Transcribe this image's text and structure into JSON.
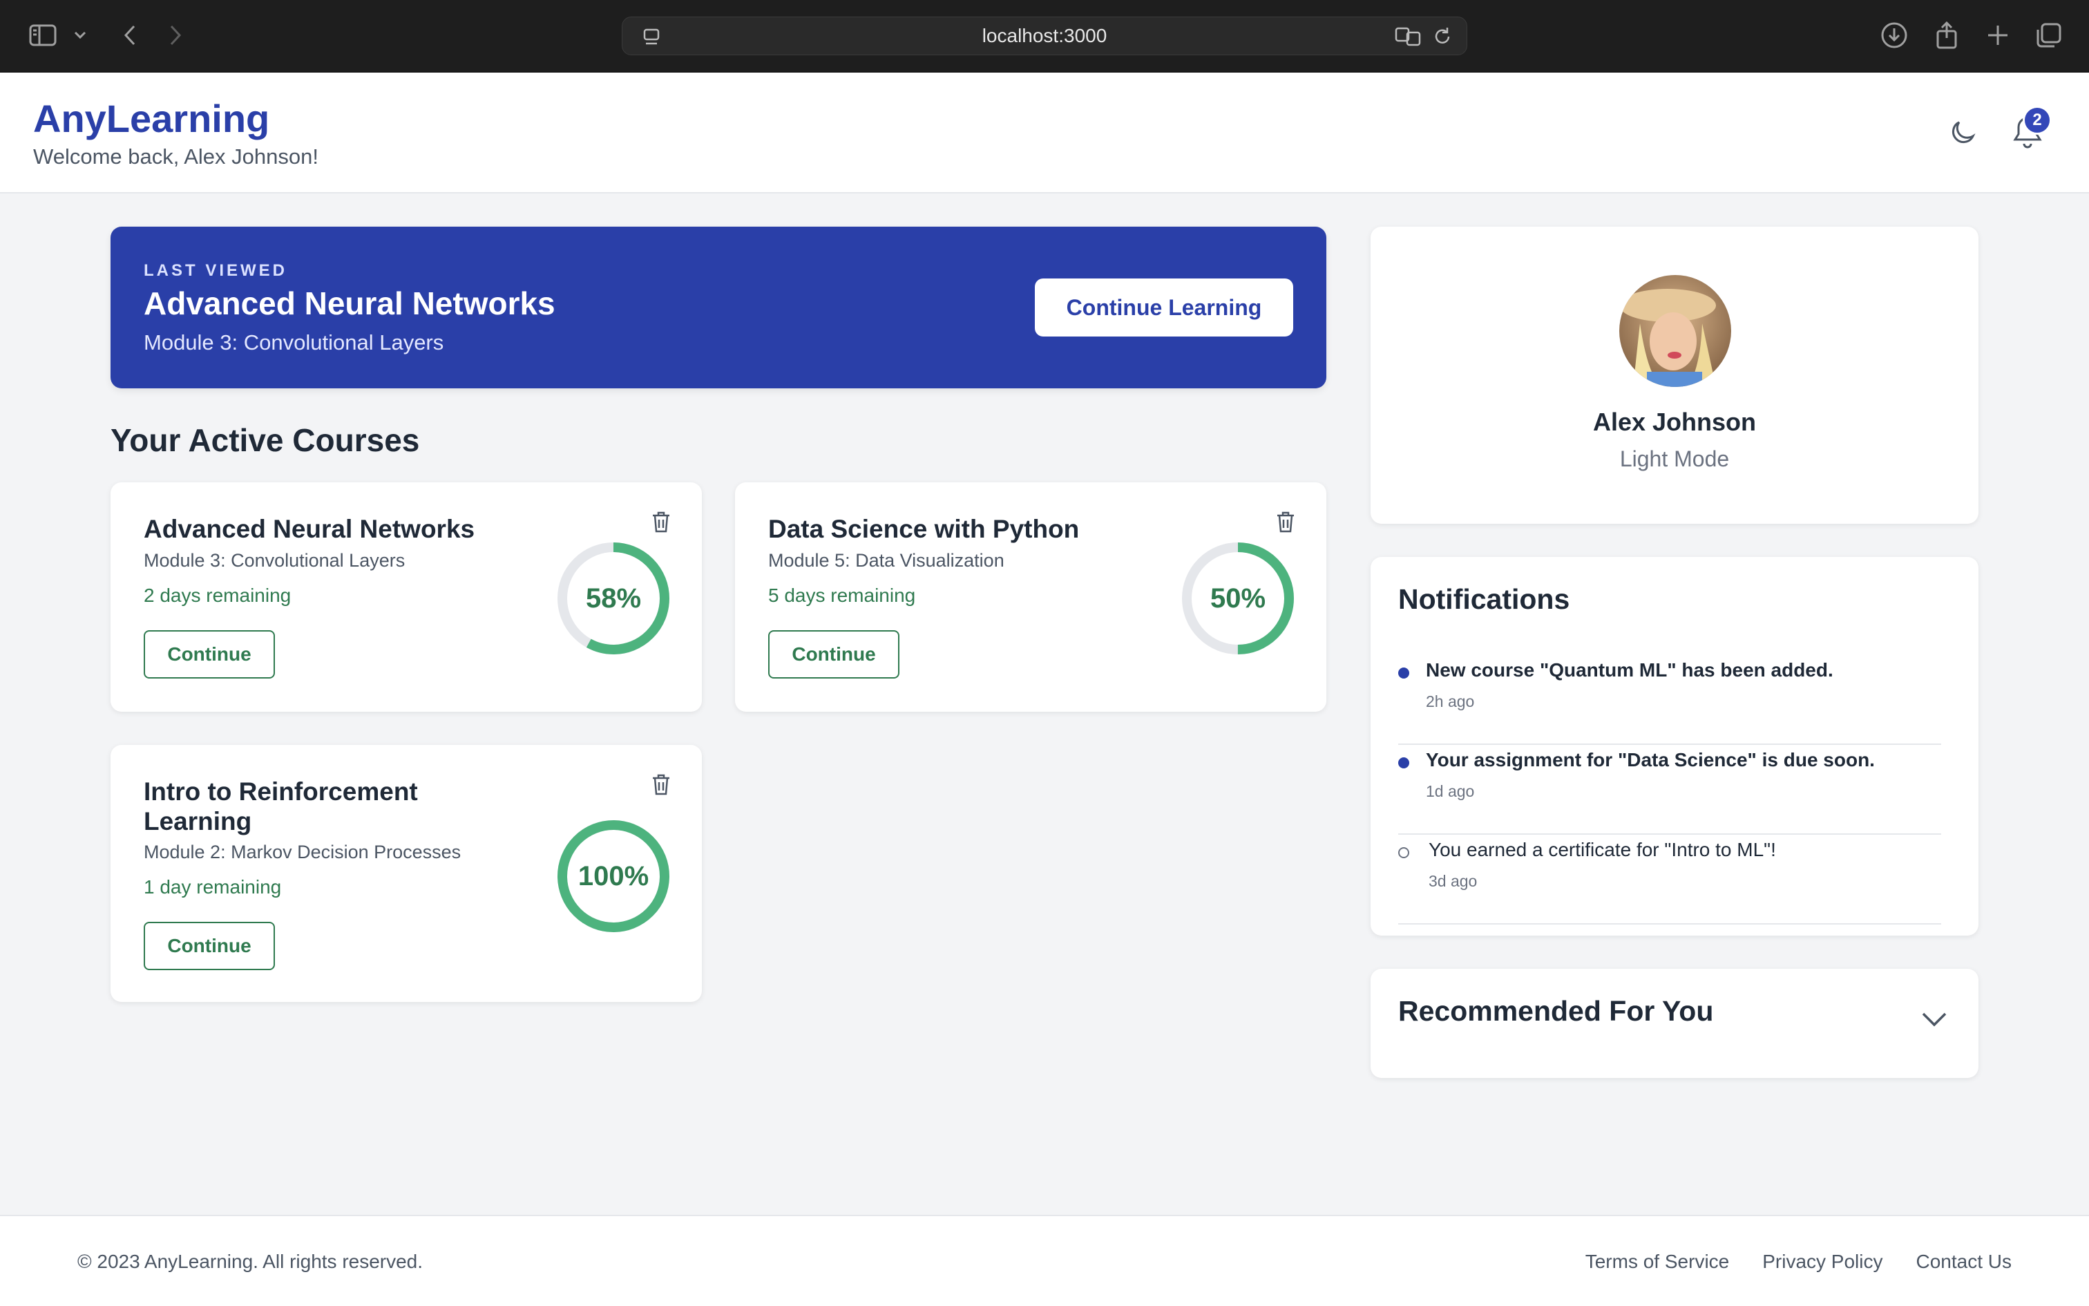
{
  "browser": {
    "url": "localhost:3000"
  },
  "header": {
    "brand": "AnyLearning",
    "welcome": "Welcome back, Alex Johnson!",
    "notification_count": "2"
  },
  "hero": {
    "kicker": "LAST VIEWED",
    "title": "Advanced Neural Networks",
    "subtitle": "Module 3: Convolutional Layers",
    "button_label": "Continue Learning"
  },
  "courses_section": {
    "title": "Your Active Courses",
    "courses": [
      {
        "title": "Advanced Neural Networks",
        "module": "Module 3: Convolutional Layers",
        "remaining": "2 days remaining",
        "progress_label": "58%",
        "progress": 58,
        "button_label": "Continue"
      },
      {
        "title": "Data Science with Python",
        "module": "Module 5: Data Visualization",
        "remaining": "5 days remaining",
        "progress_label": "50%",
        "progress": 50,
        "button_label": "Continue"
      },
      {
        "title": "Intro to Reinforcement Learning",
        "module": "Module 2: Markov Decision Processes",
        "remaining": "1 day remaining",
        "progress_label": "100%",
        "progress": 100,
        "button_label": "Continue"
      }
    ]
  },
  "profile": {
    "name": "Alex Johnson",
    "mode": "Light Mode"
  },
  "notifications": {
    "title": "Notifications",
    "items": [
      {
        "text": "New course \"Quantum ML\" has been added.",
        "time": "2h ago",
        "unread": true
      },
      {
        "text": "Your assignment for \"Data Science\" is due soon.",
        "time": "1d ago",
        "unread": true
      },
      {
        "text": "You earned a certificate for \"Intro to ML\"!",
        "time": "3d ago",
        "unread": false
      }
    ]
  },
  "recommended": {
    "title": "Recommended For You"
  },
  "footer": {
    "copyright": "© 2023 AnyLearning. All rights reserved.",
    "links": [
      "Terms of Service",
      "Privacy Policy",
      "Contact Us"
    ]
  },
  "colors": {
    "primary": "#2a3fa8",
    "success": "#2f7a4f",
    "ring_fill": "#4db37e",
    "ring_track": "#e5e7eb"
  }
}
